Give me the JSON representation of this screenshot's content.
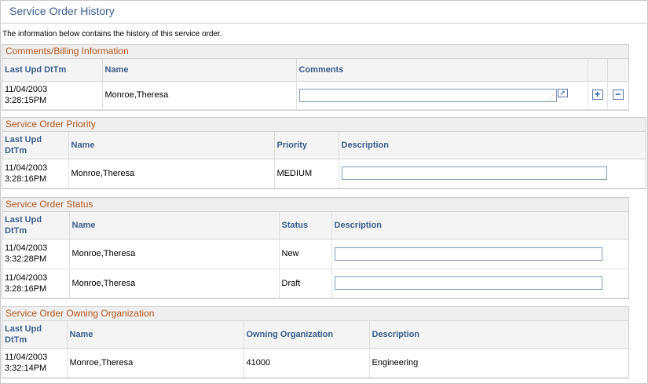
{
  "page": {
    "title": "Service Order History",
    "intro": "The information below contains the history of this service order."
  },
  "comments": {
    "title": "Comments/Billing Information",
    "headers": {
      "dttm": "Last Upd DtTm",
      "name": "Name",
      "comments": "Comments"
    },
    "rows": [
      {
        "dttm_line1": "11/04/2003",
        "dttm_line2": "3:28:15PM",
        "name": "Monroe,Theresa",
        "comments": ""
      }
    ],
    "icons": {
      "expand": "expand-textarea-icon",
      "add": "add-row-icon",
      "delete": "delete-row-icon"
    }
  },
  "priority": {
    "title": "Service Order Priority",
    "headers": {
      "dttm_line1": "Last Upd",
      "dttm_line2": "DtTm",
      "name": "Name",
      "priority": "Priority",
      "description": "Description"
    },
    "rows": [
      {
        "dttm_line1": "11/04/2003",
        "dttm_line2": "3:28:16PM",
        "name": "Monroe,Theresa",
        "priority": "MEDIUM",
        "description": ""
      }
    ]
  },
  "status": {
    "title": "Service Order Status",
    "headers": {
      "dttm_line1": "Last Upd",
      "dttm_line2": "DtTm",
      "name": "Name",
      "status": "Status",
      "description": "Description"
    },
    "rows": [
      {
        "dttm_line1": "11/04/2003",
        "dttm_line2": "3:32:28PM",
        "name": "Monroe,Theresa",
        "status": "New",
        "description": ""
      },
      {
        "dttm_line1": "11/04/2003",
        "dttm_line2": "3:28:16PM",
        "name": "Monroe,Theresa",
        "status": "Draft",
        "description": ""
      }
    ]
  },
  "owning": {
    "title": "Service Order Owning Organization",
    "headers": {
      "dttm_line1": "Last Upd",
      "dttm_line2": "DtTm",
      "name": "Name",
      "org": "Owning Organization",
      "description": "Description"
    },
    "rows": [
      {
        "dttm_line1": "11/04/2003",
        "dttm_line2": "3:32:14PM",
        "name": "Monroe,Theresa",
        "org": "41000",
        "description": "Engineering"
      }
    ]
  },
  "colors": {
    "title": "#3a5c8c",
    "section_title": "#b2561c",
    "header_text": "#3a5c8c"
  }
}
